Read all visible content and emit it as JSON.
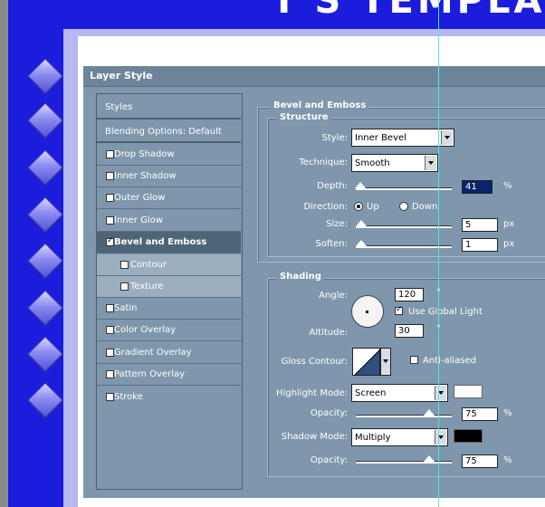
{
  "banner": {
    "text": "T'S TEMPLA"
  },
  "dialog": {
    "title": "Layer Style"
  },
  "styles_list": {
    "header": "Styles",
    "blending": "Blending Options: Default",
    "items": [
      {
        "label": "Drop Shadow",
        "checked": false
      },
      {
        "label": "Inner Shadow",
        "checked": false
      },
      {
        "label": "Outer Glow",
        "checked": false
      },
      {
        "label": "Inner Glow",
        "checked": false
      },
      {
        "label": "Bevel and Emboss",
        "checked": true
      },
      {
        "label": "Contour",
        "checked": false
      },
      {
        "label": "Texture",
        "checked": false
      },
      {
        "label": "Satin",
        "checked": false
      },
      {
        "label": "Color Overlay",
        "checked": false
      },
      {
        "label": "Gradient Overlay",
        "checked": false
      },
      {
        "label": "Pattern Overlay",
        "checked": false
      },
      {
        "label": "Stroke",
        "checked": false
      }
    ]
  },
  "bevel": {
    "section_title": "Bevel and Emboss",
    "structure_title": "Structure",
    "style_label": "Style:",
    "style_value": "Inner Bevel",
    "technique_label": "Technique:",
    "technique_value": "Smooth",
    "depth_label": "Depth:",
    "depth_value": "41",
    "depth_unit": "%",
    "direction_label": "Direction:",
    "direction_up": "Up",
    "direction_down": "Down",
    "size_label": "Size:",
    "size_value": "5",
    "size_unit": "px",
    "soften_label": "Soften:",
    "soften_value": "1",
    "soften_unit": "px"
  },
  "shading": {
    "title": "Shading",
    "angle_label": "Angle:",
    "angle_value": "120",
    "angle_unit": "°",
    "use_global_light": "Use Global Light",
    "altitude_label": "Altitude:",
    "altitude_value": "30",
    "altitude_unit": "°",
    "gloss_contour_label": "Gloss Contour:",
    "anti_aliased": "Anti-aliased",
    "highlight_mode_label": "Highlight Mode:",
    "highlight_mode_value": "Screen",
    "highlight_opacity_label": "Opacity:",
    "highlight_opacity_value": "75",
    "highlight_opacity_unit": "%",
    "shadow_mode_label": "Shadow Mode:",
    "shadow_mode_value": "Multiply",
    "shadow_opacity_label": "Opacity:",
    "shadow_opacity_value": "75",
    "shadow_opacity_unit": "%",
    "highlight_color": "#ffffff",
    "shadow_color": "#000000"
  },
  "colors": {
    "canvas_blue": "#1c1cdc",
    "dialog_bg": "#7e97ac",
    "selected_row": "#4e6578"
  }
}
